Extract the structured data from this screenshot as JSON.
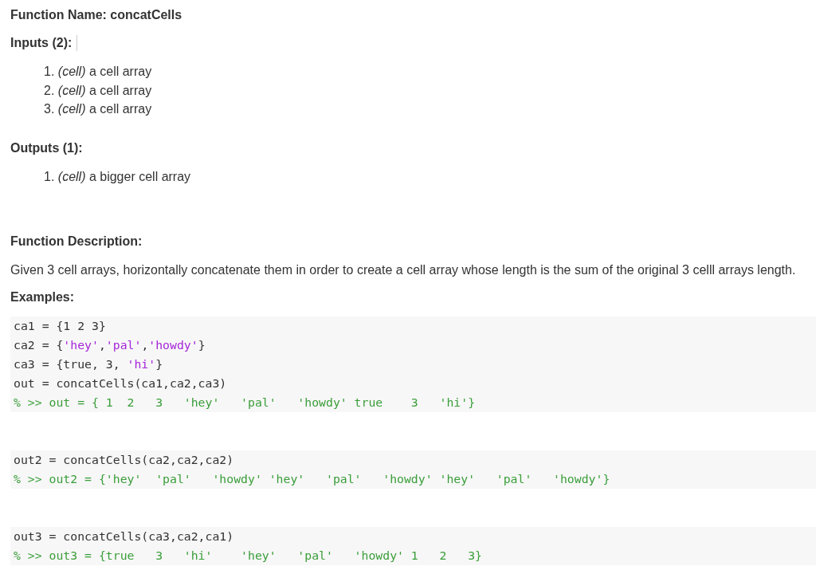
{
  "function_name": "Function Name: concatCells",
  "inputs": {
    "heading": "Inputs (2):",
    "items": [
      {
        "text": "1. *(cell)* a cell array"
      },
      {
        "text": "2. *(cell)* a cell array"
      },
      {
        "text": "3. *(cell)* a cell array"
      }
    ]
  },
  "outputs": {
    "heading": "Outputs (1):",
    "items": [
      {
        "text": "1. *(cell)* a bigger cell array"
      }
    ]
  },
  "description": {
    "heading": "Function Description:",
    "text": "Given 3 cell arrays, horizontally concatenate them in order to create a cell array whose length is the sum of the original 3 celll arrays length."
  },
  "examples": {
    "heading": "Examples:",
    "blocks": [
      {
        "lines": [
          [
            {
              "kind": "plain",
              "text": "ca1 = {1 2 3}"
            }
          ],
          [
            {
              "kind": "plain",
              "text": "ca2 = {"
            },
            {
              "kind": "string",
              "text": "'hey'"
            },
            {
              "kind": "plain",
              "text": ","
            },
            {
              "kind": "string",
              "text": "'pal'"
            },
            {
              "kind": "plain",
              "text": ","
            },
            {
              "kind": "string",
              "text": "'howdy'"
            },
            {
              "kind": "plain",
              "text": "}"
            }
          ],
          [
            {
              "kind": "plain",
              "text": "ca3 = {true, 3, "
            },
            {
              "kind": "string",
              "text": "'hi'"
            },
            {
              "kind": "plain",
              "text": "}"
            }
          ],
          [
            {
              "kind": "plain",
              "text": "out = concatCells(ca1,ca2,ca3)"
            }
          ],
          [
            {
              "kind": "comment",
              "text": "% >> out = { 1  2   3   'hey'   'pal'   'howdy' true    3   'hi'}"
            }
          ]
        ]
      },
      {
        "lines": [
          [
            {
              "kind": "plain",
              "text": "out2 = concatCells(ca2,ca2,ca2)"
            }
          ],
          [
            {
              "kind": "comment",
              "text": "% >> out2 = {'hey'  'pal'   'howdy' 'hey'   'pal'   'howdy' 'hey'   'pal'   'howdy'}"
            }
          ]
        ]
      },
      {
        "lines": [
          [
            {
              "kind": "plain",
              "text": "out3 = concatCells(ca3,ca2,ca1)"
            }
          ],
          [
            {
              "kind": "comment",
              "text": "% >> out3 = {true   3   'hi'    'hey'   'pal'   'howdy' 1   2   3}"
            }
          ]
        ]
      }
    ]
  }
}
